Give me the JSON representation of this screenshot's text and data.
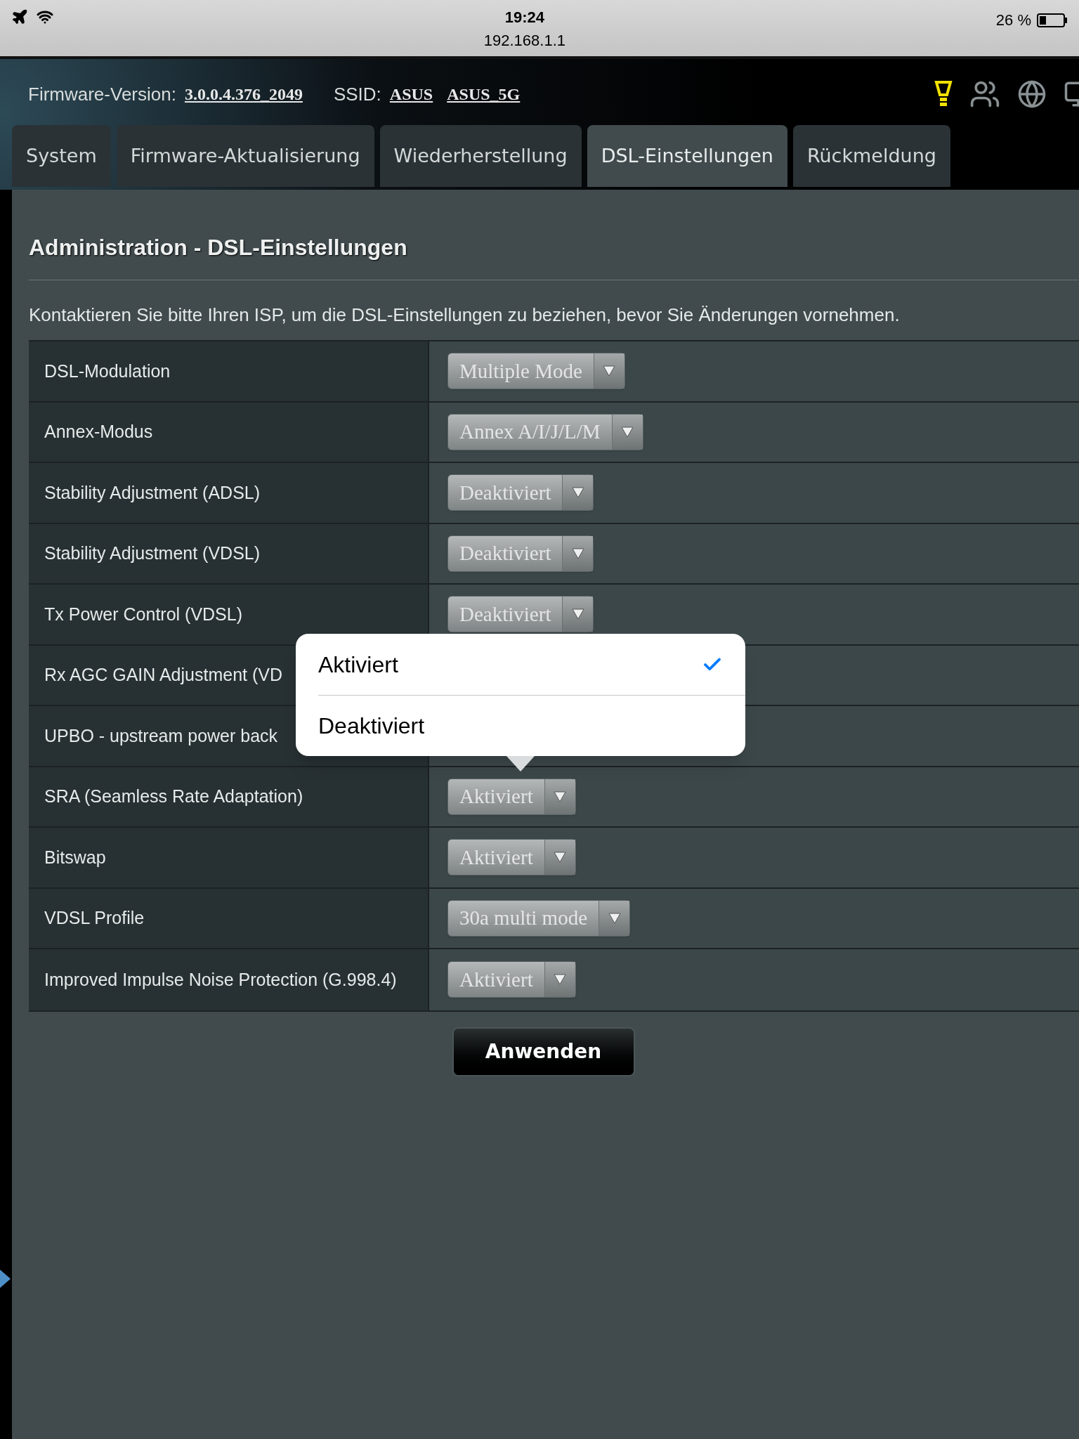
{
  "status_bar": {
    "time": "19:24",
    "url": "192.168.1.1",
    "battery": "26 %"
  },
  "header": {
    "firmware_label": "Firmware-Version:",
    "firmware_version": "3.0.0.4.376_2049",
    "ssid_label": "SSID:",
    "ssids": [
      "ASUS",
      "ASUS_5G"
    ]
  },
  "tabs": [
    {
      "label": "System",
      "selected": false
    },
    {
      "label": "Firmware-Aktualisierung",
      "selected": false
    },
    {
      "label": "Wiederherstellung",
      "selected": false
    },
    {
      "label": "DSL-Einstellungen",
      "selected": true
    },
    {
      "label": "Rückmeldung",
      "selected": false
    }
  ],
  "page": {
    "title": "Administration - DSL-Einstellungen",
    "description": "Kontaktieren Sie bitte Ihren ISP, um die DSL-Einstellungen zu beziehen, bevor Sie Änderungen vornehmen."
  },
  "settings": [
    {
      "label": "DSL-Modulation",
      "value": "Multiple Mode"
    },
    {
      "label": "Annex-Modus",
      "value": "Annex A/I/J/L/M"
    },
    {
      "label": "Stability Adjustment (ADSL)",
      "value": "Deaktiviert"
    },
    {
      "label": "Stability Adjustment (VDSL)",
      "value": "Deaktiviert"
    },
    {
      "label": "Tx Power Control (VDSL)",
      "value": "Deaktiviert"
    },
    {
      "label": "Rx AGC GAIN Adjustment (VD"
    },
    {
      "label": "UPBO - upstream power back"
    },
    {
      "label": "SRA (Seamless Rate Adaptation)",
      "value": "Aktiviert"
    },
    {
      "label": "Bitswap",
      "value": "Aktiviert"
    },
    {
      "label": "VDSL Profile",
      "value": "30a multi mode"
    },
    {
      "label": "Improved Impulse Noise Protection (G.998.4)",
      "value": "Aktiviert"
    }
  ],
  "popover": {
    "options": [
      {
        "label": "Aktiviert",
        "selected": true
      },
      {
        "label": "Deaktiviert",
        "selected": false
      }
    ]
  },
  "apply_button": "Anwenden"
}
